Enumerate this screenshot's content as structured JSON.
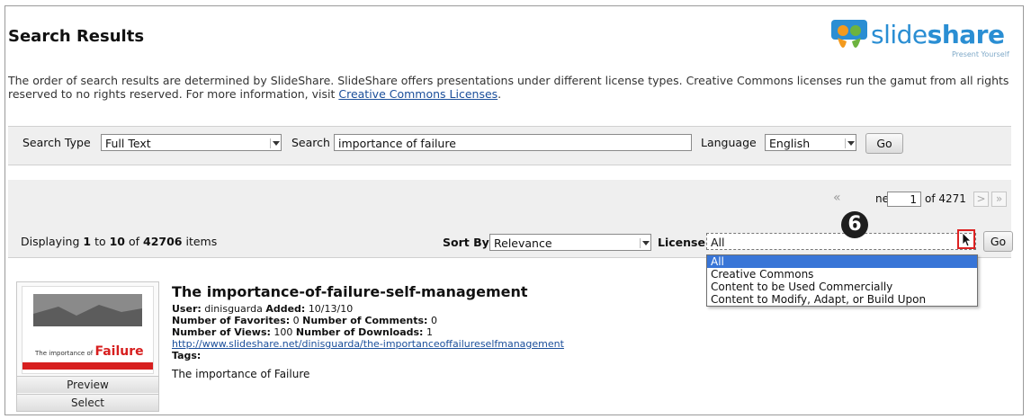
{
  "header": {
    "title": "Search Results",
    "logo_text_a": "slide",
    "logo_text_b": "share",
    "logo_tagline": "Present Yourself"
  },
  "intro": {
    "text": "The order of search results are determined by SlideShare. SlideShare offers presentations under different license types. Creative Commons licenses run the gamut from all rights reserved to no rights reserved. For more information, visit ",
    "link": "Creative Commons Licenses",
    "tail": "."
  },
  "search": {
    "type_label": "Search Type",
    "type_value": "Full Text",
    "search_label": "Search",
    "query": "importance of failure",
    "language_label": "Language",
    "language_value": "English",
    "go_label": "Go"
  },
  "pager": {
    "first": "«",
    "page_label": "ne",
    "page_value": "1",
    "of_label": "of 4271",
    "next": ">",
    "last": "»"
  },
  "results_bar": {
    "display_prefix": "Displaying ",
    "from": "1",
    "to_word": " to ",
    "to": "10",
    "of_word": " of ",
    "total": "42706",
    "suffix": " items",
    "sort_label": "Sort By",
    "sort_value": "Relevance",
    "license_label": "License",
    "license_value": "All",
    "go_label": "Go"
  },
  "step_marker": "6",
  "license_options": [
    "All",
    "Creative Commons",
    "Content to be Used Commercially",
    "Content to Modify, Adapt, or Build Upon"
  ],
  "result": {
    "title": "The importance-of-failure-self-management",
    "user_label": "User:",
    "user": "dinisguarda",
    "added_label": "Added:",
    "added": "10/13/10",
    "favorites_label": "Number of Favorites:",
    "favorites": "0",
    "comments_label": "Number of Comments:",
    "comments": "0",
    "views_label": "Number of Views:",
    "views": "100",
    "downloads_label": "Number of Downloads:",
    "downloads": "1",
    "url": "http://www.slideshare.net/dinisguarda/the-importanceoffailureselfmanagement",
    "tags_label": "Tags:",
    "description": "The importance of Failure",
    "thumb_caption_a": "The importance of",
    "thumb_caption_b": "Failure",
    "preview_label": "Preview",
    "select_label": "Select"
  },
  "colors": {
    "brand_blue": "#2a8ed3",
    "link": "#1a4e9a",
    "selection": "#3875d7",
    "highlight_box": "#dd2222",
    "thumb_red": "#d71f1f"
  }
}
